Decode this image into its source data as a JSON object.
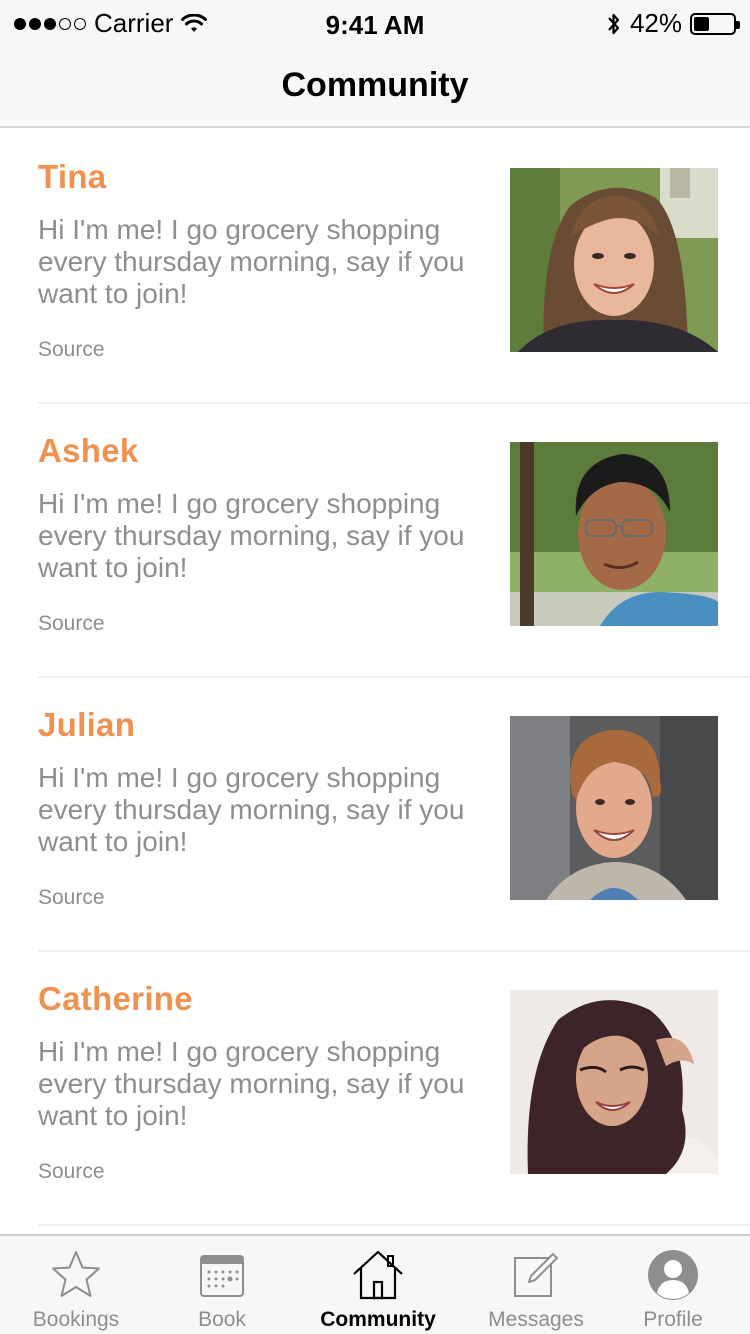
{
  "status_bar": {
    "carrier": "Carrier",
    "time": "9:41 AM",
    "battery_percent": "42%",
    "battery_level": 0.42,
    "signal_bars_filled": 3,
    "signal_bars_total": 5
  },
  "nav": {
    "title": "Community"
  },
  "feed": {
    "items": [
      {
        "name": "Tina",
        "bio": "Hi I'm me! I go grocery shopping every thursday morning, say if you want to join!",
        "source": "Source",
        "photo": "woman-smiling-photo"
      },
      {
        "name": "Ashek",
        "bio": "Hi I'm me! I go grocery shopping every thursday morning, say if you want to join!",
        "source": "Source",
        "photo": "man-glasses-photo"
      },
      {
        "name": "Julian",
        "bio": "Hi I'm me! I go grocery shopping every thursday morning, say if you want to join!",
        "source": "Source",
        "photo": "man-curly-hair-photo"
      },
      {
        "name": "Catherine",
        "bio": "Hi I'm me! I go grocery shopping every thursday morning, say if you want to join!",
        "source": "Source",
        "photo": "woman-long-hair-photo"
      }
    ]
  },
  "tabbar": {
    "tabs": [
      {
        "label": "Bookings",
        "icon": "star-icon",
        "active": false
      },
      {
        "label": "Book",
        "icon": "calendar-icon",
        "active": false
      },
      {
        "label": "Community",
        "icon": "house-icon",
        "active": true
      },
      {
        "label": "Messages",
        "icon": "compose-icon",
        "active": false
      },
      {
        "label": "Profile",
        "icon": "profile-icon",
        "active": false
      }
    ]
  },
  "colors": {
    "accent_name": "#f0914f",
    "text_secondary": "#8e8e8e",
    "bar_background": "#f7f7f7"
  }
}
